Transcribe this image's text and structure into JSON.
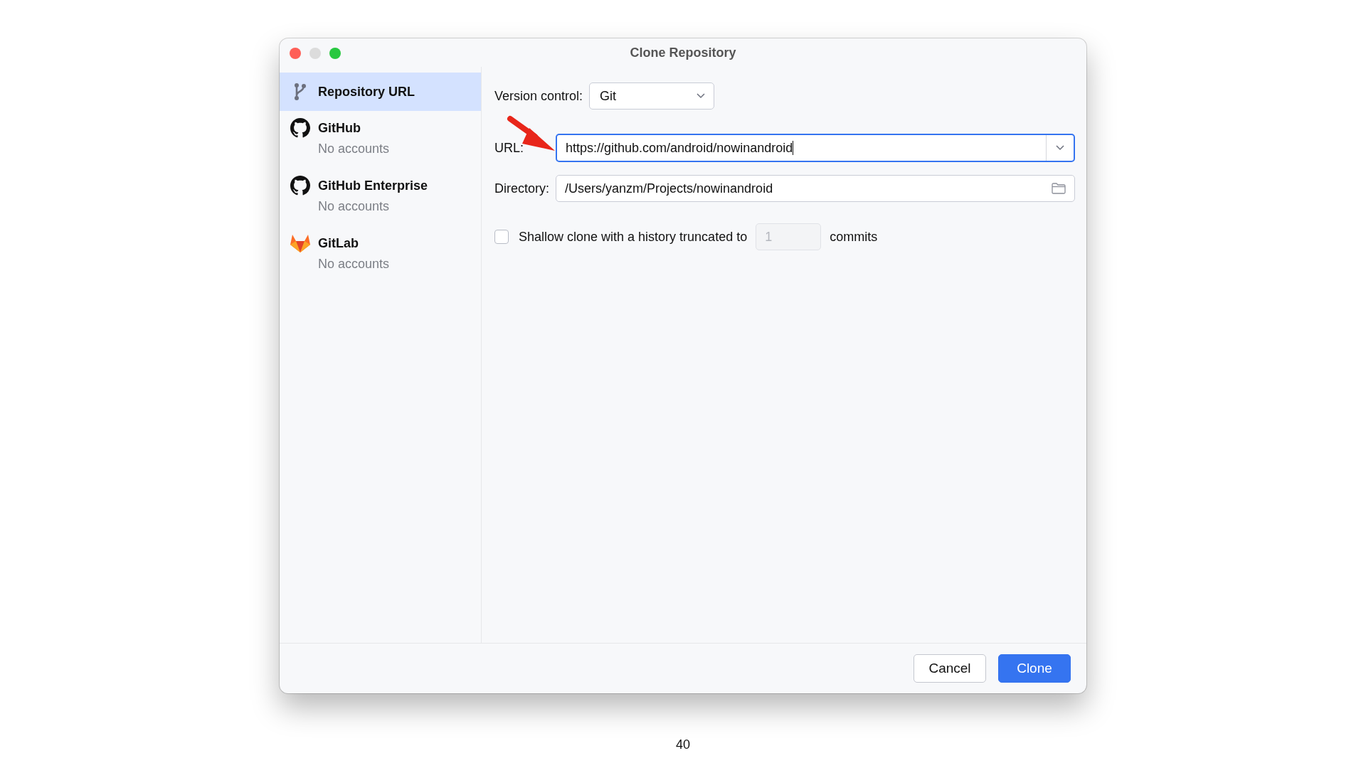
{
  "window": {
    "title": "Clone Repository"
  },
  "sidebar": {
    "items": [
      {
        "kind": "url",
        "title": "Repository URL",
        "selected": true
      },
      {
        "kind": "github",
        "title": "GitHub",
        "subtitle": "No accounts",
        "selected": false
      },
      {
        "kind": "github",
        "title": "GitHub Enterprise",
        "subtitle": "No accounts",
        "selected": false
      },
      {
        "kind": "gitlab",
        "title": "GitLab",
        "subtitle": "No accounts",
        "selected": false
      }
    ]
  },
  "form": {
    "version_control": {
      "label": "Version control:",
      "value": "Git"
    },
    "url": {
      "label": "URL:",
      "value": "https://github.com/android/nowinandroid",
      "focused": true
    },
    "directory": {
      "label": "Directory:",
      "value": "/Users/yanzm/Projects/nowinandroid"
    },
    "shallow_clone": {
      "label": "Shallow clone with a history truncated to",
      "checked": false,
      "depth": "1",
      "depth_disabled": true,
      "suffix": "commits"
    }
  },
  "buttons": [
    {
      "label": "Cancel",
      "primary": false
    },
    {
      "label": "Clone",
      "primary": true
    }
  ],
  "page_number": "40"
}
